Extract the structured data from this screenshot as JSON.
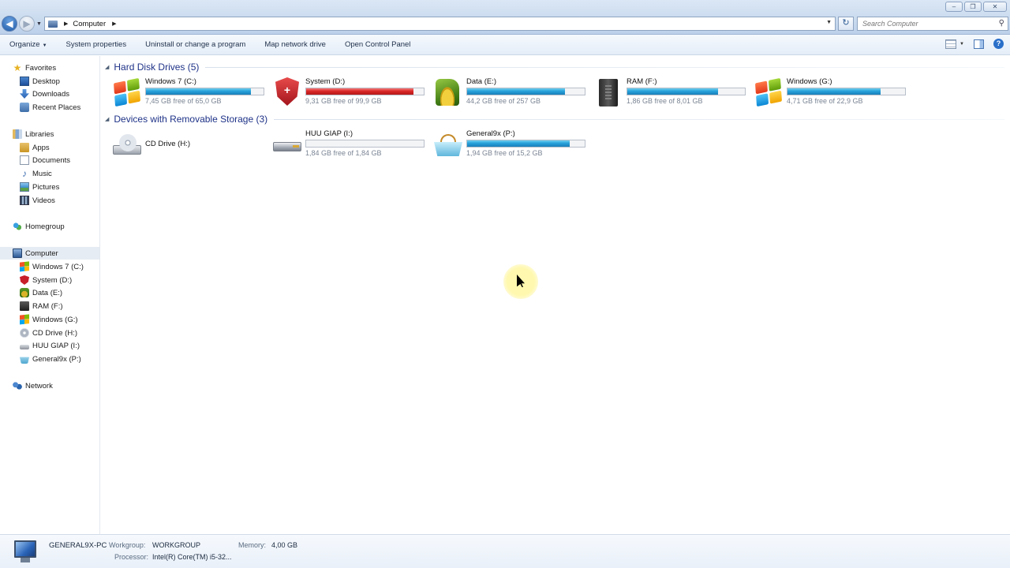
{
  "window": {
    "address_segment": "Computer",
    "search_placeholder": "Search Computer",
    "buttons": {
      "minimize": "–",
      "maximize": "❐",
      "close": "✕"
    }
  },
  "toolbar": {
    "items": [
      "Organize",
      "System properties",
      "Uninstall or change a program",
      "Map network drive",
      "Open Control Panel"
    ]
  },
  "nav": {
    "favorites": {
      "label": "Favorites",
      "items": [
        "Desktop",
        "Downloads",
        "Recent Places"
      ]
    },
    "libraries": {
      "label": "Libraries",
      "items": [
        "Apps",
        "Documents",
        "Music",
        "Pictures",
        "Videos"
      ]
    },
    "homegroup": "Homegroup",
    "computer": {
      "label": "Computer",
      "items": [
        "Windows 7 (C:)",
        "System (D:)",
        "Data (E:)",
        "RAM (F:)",
        "Windows (G:)",
        "CD Drive (H:)",
        "HUU GIAP (I:)",
        "General9x (P:)"
      ]
    },
    "network": "Network"
  },
  "groups": {
    "hdd": {
      "title": "Hard Disk Drives (5)",
      "drives": [
        {
          "name": "Windows 7 (C:)",
          "free": "7,45 GB free of 65,0 GB",
          "used_fraction": 0.89,
          "icon": "windows-logo-icon",
          "bar_color": "#26a0da"
        },
        {
          "name": "System (D:)",
          "free": "9,31 GB free of 99,9 GB",
          "used_fraction": 0.91,
          "icon": "red-shield-icon",
          "bar_color": "#da2626"
        },
        {
          "name": "Data (E:)",
          "free": "44,2 GB free of 257 GB",
          "used_fraction": 0.83,
          "icon": "money-bag-icon",
          "bar_color": "#26a0da"
        },
        {
          "name": "RAM (F:)",
          "free": "1,86 GB free of 8,01 GB",
          "used_fraction": 0.77,
          "icon": "ram-drive-icon",
          "bar_color": "#26a0da"
        },
        {
          "name": "Windows (G:)",
          "free": "4,71 GB free of 22,9 GB",
          "used_fraction": 0.79,
          "icon": "windows-logo-icon",
          "bar_color": "#26a0da"
        }
      ]
    },
    "removable": {
      "title": "Devices with Removable Storage (3)",
      "drives": [
        {
          "name": "CD Drive (H:)",
          "icon": "cd-drive-icon"
        },
        {
          "name": "HUU GIAP (I:)",
          "free": "1,84 GB free of 1,84 GB",
          "used_fraction": 0.0,
          "icon": "usb-drive-icon",
          "bar_color": "#26a0da"
        },
        {
          "name": "General9x (P:)",
          "free": "1,94 GB free of 15,2 GB",
          "used_fraction": 0.87,
          "icon": "basket-drive-icon",
          "bar_color": "#26a0da"
        }
      ]
    }
  },
  "details": {
    "pc_name": "GENERAL9X-PC",
    "workgroup_label": "Workgroup:",
    "workgroup": "WORKGROUP",
    "memory_label": "Memory:",
    "memory": "4,00 GB",
    "processor_label": "Processor:",
    "processor": "Intel(R) Core(TM) i5-32..."
  }
}
